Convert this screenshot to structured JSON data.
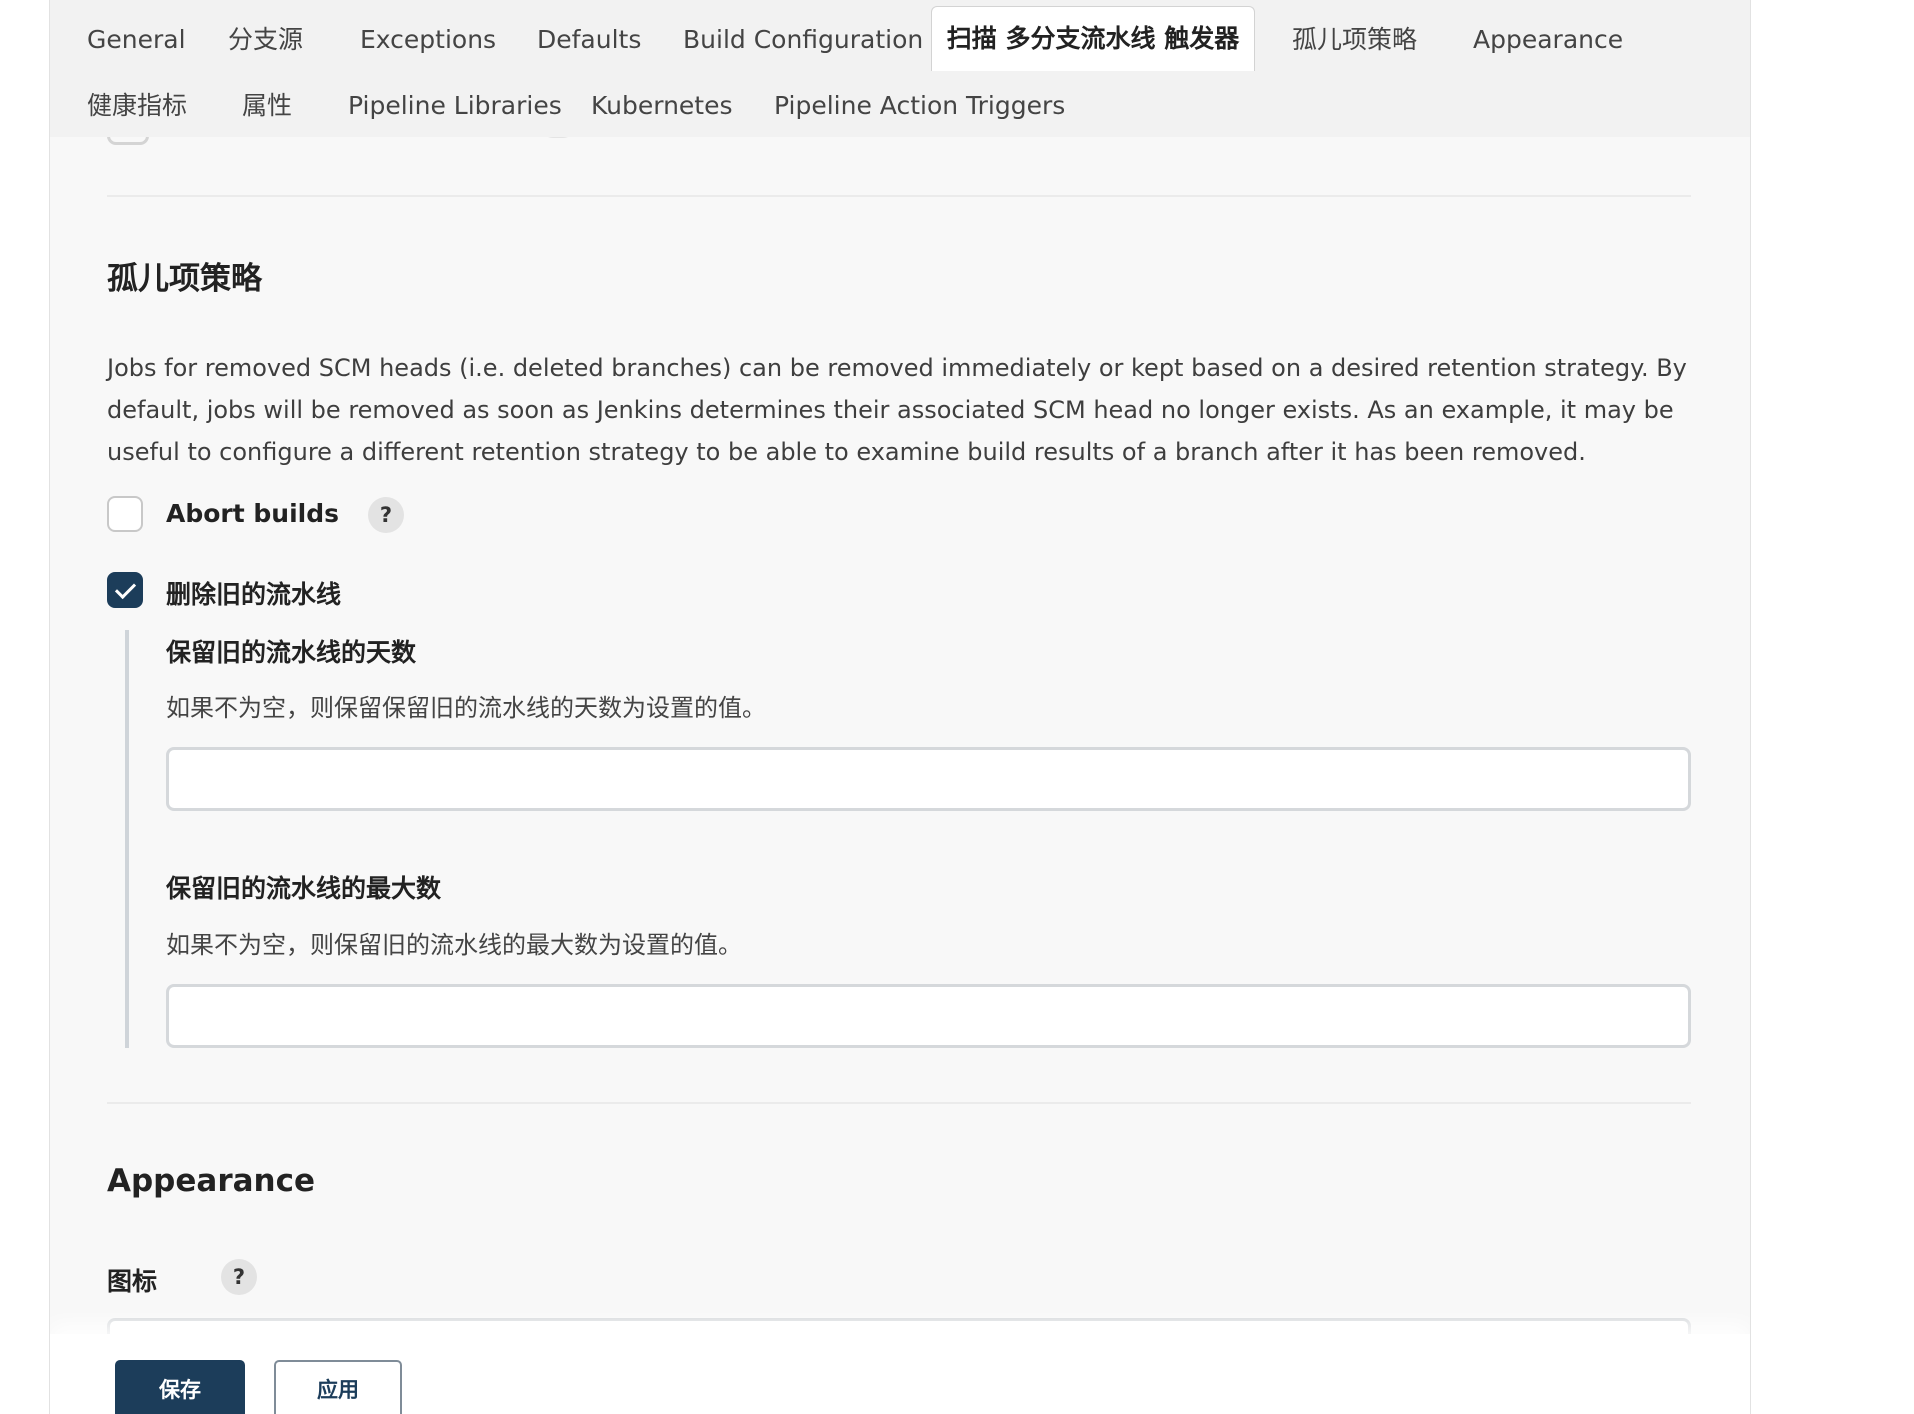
{
  "tabs": [
    {
      "label": "General"
    },
    {
      "label": "分支源"
    },
    {
      "label": "Exceptions"
    },
    {
      "label": "Defaults"
    },
    {
      "label": "Build Configuration"
    },
    {
      "label": "扫描 多分支流水线 触发器",
      "active": true
    },
    {
      "label": "孤儿项策略"
    },
    {
      "label": "Appearance"
    },
    {
      "label": "健康指标"
    },
    {
      "label": "属性"
    },
    {
      "label": "Pipeline Libraries"
    },
    {
      "label": "Kubernetes"
    },
    {
      "label": "Pipeline Action Triggers"
    }
  ],
  "orphan_section": {
    "title": "孤儿项策略",
    "description": "Jobs for removed SCM heads (i.e. deleted branches) can be removed immediately or kept based on a desired retention strategy. By default, jobs will be removed as soon as Jenkins determines their associated SCM head no longer exists. As an example, it may be useful to configure a different retention strategy to be able to examine build results of a branch after it has been removed.",
    "abort_builds": {
      "label": "Abort builds",
      "checked": false,
      "help": "?"
    },
    "discard_old": {
      "label": "删除旧的流水线",
      "checked": true,
      "days_to_keep": {
        "label": "保留旧的流水线的天数",
        "description": "如果不为空，则保留保留旧的流水线的天数为设置的值。",
        "value": "",
        "placeholder": ""
      },
      "max_to_keep": {
        "label": "保留旧的流水线的最大数",
        "description": "如果不为空，则保留旧的流水线的最大数为设置的值。",
        "value": "",
        "placeholder": ""
      }
    }
  },
  "appearance_section": {
    "title": "Appearance",
    "icon_label": "图标",
    "help": "?"
  },
  "actions": {
    "save_label": "保存",
    "apply_label": "应用"
  },
  "colors": {
    "primary": "#1c3d5a",
    "panel_bg": "#f8f8f8",
    "tabbar_bg": "#f2f2f2"
  }
}
